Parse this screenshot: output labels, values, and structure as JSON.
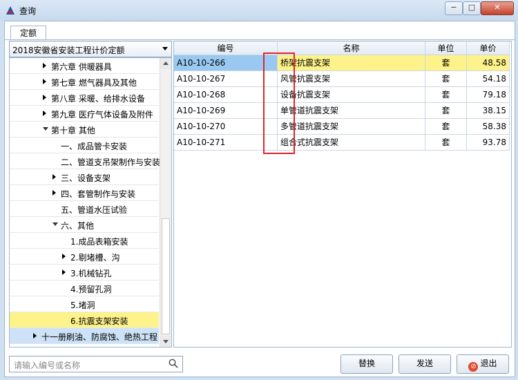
{
  "window": {
    "title": "查询",
    "minimize": "−",
    "restore": "□",
    "close": "✕"
  },
  "tab": {
    "label": "定额"
  },
  "quota_select": {
    "value": "2018安徽省安装工程计价定额"
  },
  "tree": {
    "items": [
      {
        "label": "第六章 供暖器具",
        "indent": 1,
        "expander": "collapsed",
        "state": "normal"
      },
      {
        "label": "第七章 燃气器具及其他",
        "indent": 1,
        "expander": "collapsed",
        "state": "normal"
      },
      {
        "label": "第八章 采暖、给排水设备",
        "indent": 1,
        "expander": "collapsed",
        "state": "normal"
      },
      {
        "label": "第九章 医疗气体设备及附件",
        "indent": 1,
        "expander": "collapsed",
        "state": "normal"
      },
      {
        "label": "第十章 其他",
        "indent": 1,
        "expander": "expanded",
        "state": "normal"
      },
      {
        "label": "一、成品管卡安装",
        "indent": 2,
        "expander": "none",
        "state": "normal"
      },
      {
        "label": "二、管道支吊架制作与安装",
        "indent": 2,
        "expander": "none",
        "state": "normal"
      },
      {
        "label": "三、设备支架",
        "indent": 2,
        "expander": "collapsed",
        "state": "normal"
      },
      {
        "label": "四、套管制作与安装",
        "indent": 2,
        "expander": "collapsed",
        "state": "normal"
      },
      {
        "label": "五、管道水压试验",
        "indent": 2,
        "expander": "none",
        "state": "normal"
      },
      {
        "label": "六、其他",
        "indent": 2,
        "expander": "expanded",
        "state": "normal"
      },
      {
        "label": "1.成品表箱安装",
        "indent": 3,
        "expander": "none",
        "state": "normal"
      },
      {
        "label": "2.剔堵槽、沟",
        "indent": 3,
        "expander": "collapsed",
        "state": "normal"
      },
      {
        "label": "3.机械钻孔",
        "indent": 3,
        "expander": "collapsed",
        "state": "normal"
      },
      {
        "label": "4.预留孔洞",
        "indent": 3,
        "expander": "none",
        "state": "normal"
      },
      {
        "label": "5.堵洞",
        "indent": 3,
        "expander": "none",
        "state": "normal"
      },
      {
        "label": "6.抗震支架安装",
        "indent": 3,
        "expander": "none",
        "state": "selected"
      },
      {
        "label": "十一册刷油、防腐蚀、绝热工程",
        "indent": 0,
        "expander": "collapsed",
        "state": "book"
      }
    ]
  },
  "table": {
    "columns": [
      "编号",
      "名称",
      "单位",
      "单价"
    ],
    "rows": [
      {
        "code": "A10-10-266",
        "name": "桥架抗震支架",
        "unit": "套",
        "price": "48.58"
      },
      {
        "code": "A10-10-267",
        "name": "风管抗震支架",
        "unit": "套",
        "price": "54.18"
      },
      {
        "code": "A10-10-268",
        "name": "设备抗震支架",
        "unit": "套",
        "price": "79.18"
      },
      {
        "code": "A10-10-269",
        "name": "单管道抗震支架",
        "unit": "套",
        "price": "38.15"
      },
      {
        "code": "A10-10-270",
        "name": "多管道抗震支架",
        "unit": "套",
        "price": "58.38"
      },
      {
        "code": "A10-10-271",
        "name": "组合式抗震支架",
        "unit": "套",
        "price": "93.78"
      }
    ],
    "selected_row": 0
  },
  "search": {
    "placeholder": "请输入编号或名称"
  },
  "buttons": {
    "replace": "替换",
    "send": "发送",
    "exit": "退出"
  },
  "colors": {
    "selection_yellow": "#fef38a",
    "selected_code_blue": "#99c9f0",
    "highlight_box_red": "#e0232b"
  }
}
